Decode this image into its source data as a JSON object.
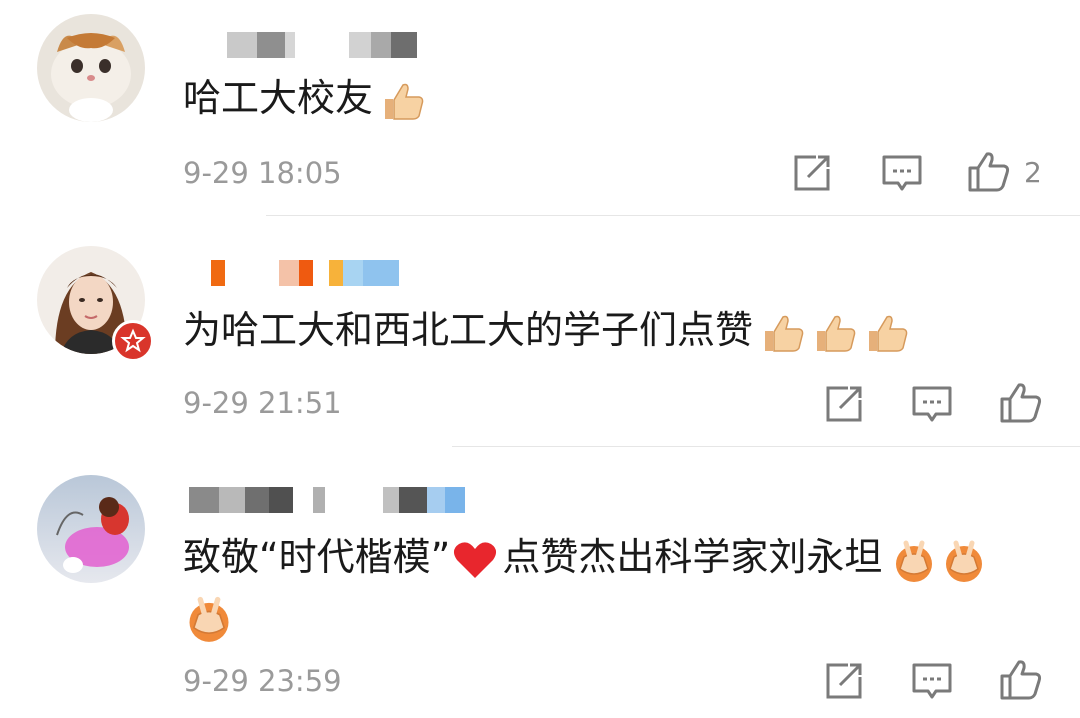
{
  "comments": [
    {
      "text": "哈工大校友",
      "emoji": [
        "thumbs-up-icon"
      ],
      "time": "9-29 18:05",
      "like_count": "2"
    },
    {
      "text": "为哈工大和西北工大的学子们点赞",
      "emoji": [
        "thumbs-up-icon",
        "thumbs-up-icon",
        "thumbs-up-icon"
      ],
      "time": "9-29 21:51",
      "like_count": "",
      "verified_badge": true
    },
    {
      "text_line1": "致敬“时代楷模”",
      "text_line1b": "点赞杰出科学家刘永坦",
      "text_line2": "",
      "emoji": [
        "heart-icon",
        "salute-hands-icon",
        "salute-hands-icon",
        "salute-hands-icon"
      ],
      "time": "9-29 23:59",
      "like_count": ""
    }
  ],
  "icons": [
    "share-icon",
    "reply-icon",
    "like-icon"
  ],
  "colors": {
    "time": "#9a9a9a",
    "icon": "#7a7a7a",
    "badge": "#d9352b",
    "heart": "#e8262d"
  }
}
